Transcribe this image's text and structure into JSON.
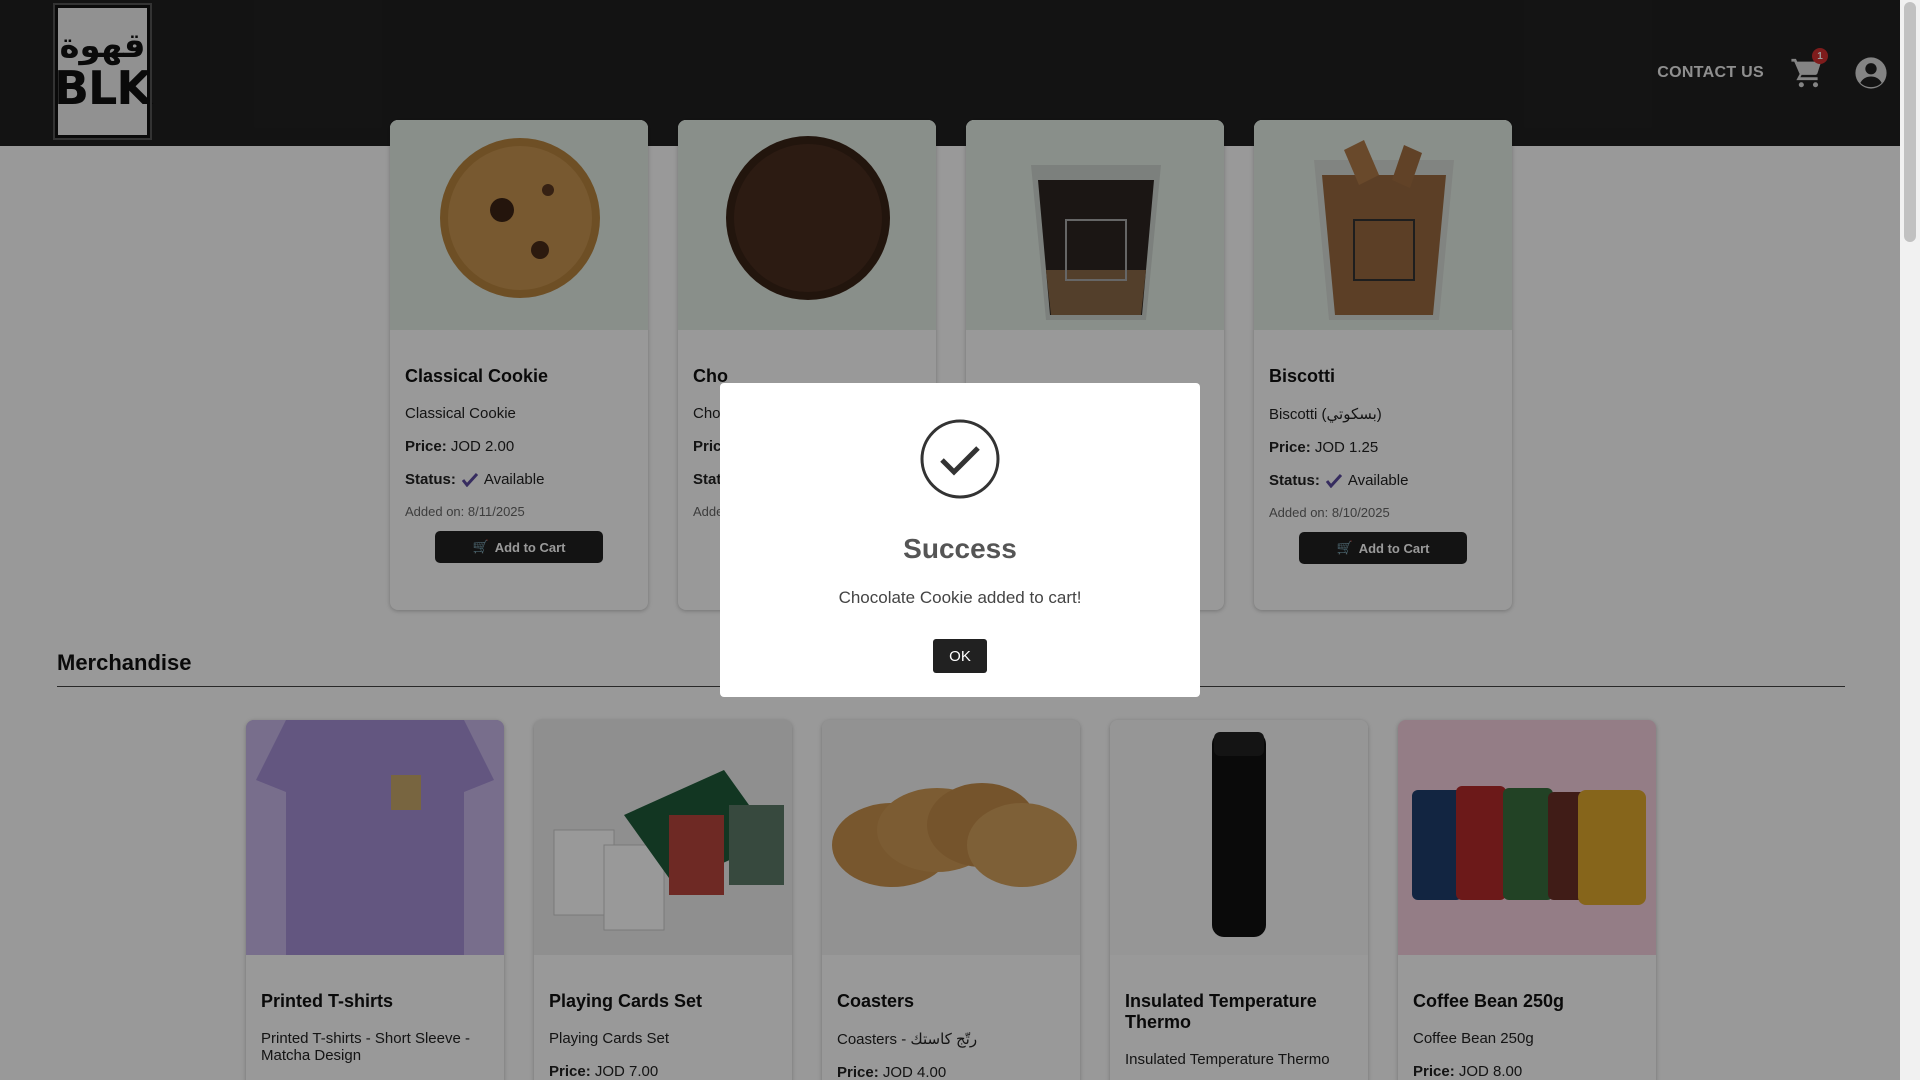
{
  "header": {
    "logo_ar": "قهوة",
    "logo_en": "BLK",
    "contact_label": "CONTACT US",
    "cart_count": "1"
  },
  "bakery_items": [
    {
      "title": "Classical Cookie",
      "desc": "Classical Cookie",
      "price_label": "Price:",
      "price": "JOD 2.00",
      "status_label": "Status:",
      "status": "Available",
      "added": "Added on: 8/11/2025",
      "button": "Add to Cart"
    },
    {
      "title": "Cho",
      "desc": "Cho",
      "price_label": "Pric",
      "price": "",
      "status_label": "Stat",
      "status": "",
      "added": "Adde",
      "button": ""
    },
    {
      "title": "",
      "desc": "",
      "price_label": "",
      "price": "",
      "status_label": "",
      "status": "",
      "added": "",
      "button": ""
    },
    {
      "title": "Biscotti",
      "desc": "Biscotti (بسكوتي)",
      "price_label": "Price:",
      "price": "JOD 1.25",
      "status_label": "Status:",
      "status": "Available",
      "added": "Added on: 8/10/2025",
      "button": "Add to Cart"
    }
  ],
  "merch_section_title": "Merchandise",
  "merch_items": [
    {
      "title": "Printed T-shirts",
      "desc": "Printed T-shirts - Short Sleeve - Matcha Design"
    },
    {
      "title": "Playing Cards Set",
      "desc": "Playing Cards Set",
      "price_label": "Price:",
      "price": "JOD 7.00"
    },
    {
      "title": "Coasters",
      "desc": "Coasters - رتّج كاستك",
      "price_label": "Price:",
      "price": "JOD 4.00"
    },
    {
      "title": "Insulated Temperature Thermo",
      "desc": "Insulated Temperature Thermo"
    },
    {
      "title": "Coffee Bean 250g",
      "desc": "Coffee Bean 250g",
      "price_label": "Price:",
      "price": "JOD 8.00"
    }
  ],
  "modal": {
    "title": "Success",
    "message": "Chocolate Cookie added to cart!",
    "ok_label": "OK"
  },
  "colors": {
    "header_bg": "#212121",
    "check_color": "#5b4a9e",
    "badge": "#d32f2f"
  }
}
